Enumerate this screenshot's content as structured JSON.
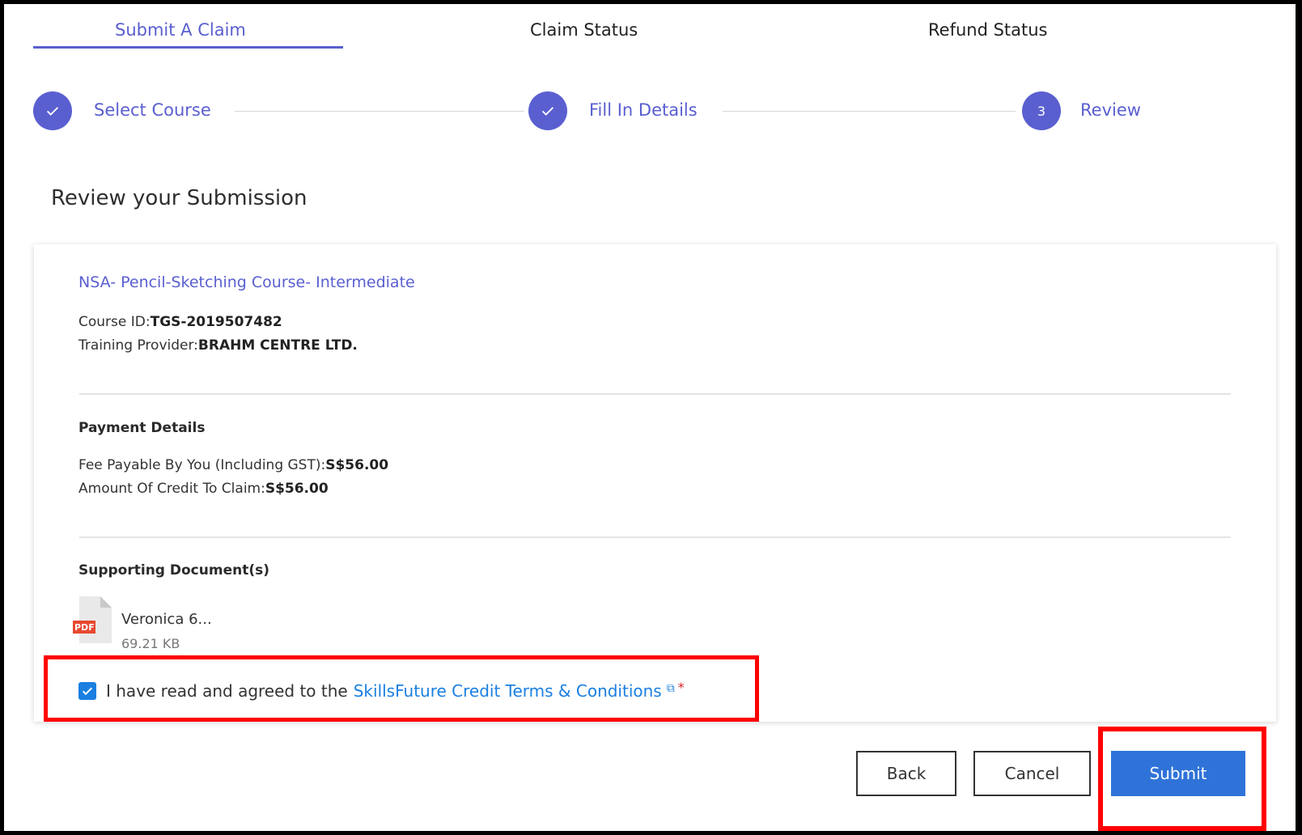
{
  "tabs": [
    {
      "label": "Submit A Claim",
      "active": true
    },
    {
      "label": "Claim Status",
      "active": false
    },
    {
      "label": "Refund Status",
      "active": false
    }
  ],
  "stepper": {
    "steps": [
      {
        "label": "Select Course",
        "state": "completed"
      },
      {
        "label": "Fill In Details",
        "state": "completed"
      },
      {
        "label": "Review",
        "state": "current",
        "number": "3"
      }
    ]
  },
  "page_title": "Review your Submission",
  "course": {
    "name": "NSA- Pencil-Sketching Course- Intermediate",
    "course_id_label": "Course ID:",
    "course_id": "TGS-2019507482",
    "provider_label": "Training Provider:",
    "provider": "BRAHM CENTRE LTD."
  },
  "payment": {
    "title": "Payment Details",
    "fee_label": "Fee Payable By You (Including GST):",
    "fee": "S$56.00",
    "credit_label": "Amount Of Credit To Claim:",
    "credit": "S$56.00"
  },
  "documents": {
    "title": "Supporting Document(s)",
    "files": [
      {
        "name": "Veronica 6...",
        "size": "69.21 KB",
        "type_badge": "PDF"
      }
    ]
  },
  "agreement": {
    "checked": true,
    "text": "I have read and agreed to the",
    "link_text": "SkillsFuture Credit Terms & Conditions",
    "required_marker": "*"
  },
  "buttons": {
    "back": "Back",
    "cancel": "Cancel",
    "submit": "Submit"
  },
  "colors": {
    "accent": "#5a5fd0",
    "link": "#1a7fe0",
    "primary_button": "#2f73d8",
    "highlight": "#ff0000",
    "pdf_badge": "#e8482f"
  }
}
